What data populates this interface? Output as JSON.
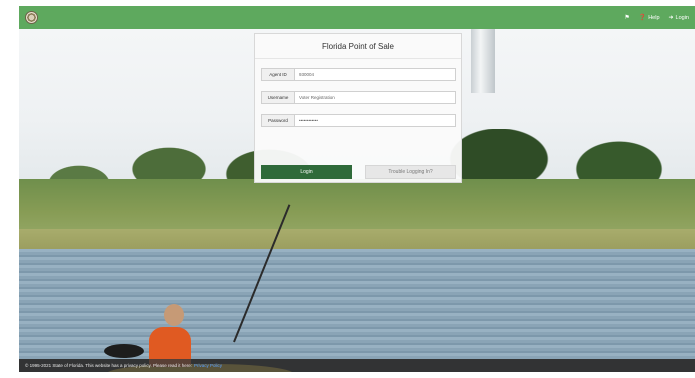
{
  "header": {
    "help_label": "Help",
    "login_label": "Login",
    "icons": [
      "state-seal-icon",
      "bell-icon",
      "help-icon",
      "login-icon"
    ]
  },
  "login": {
    "title": "Florida Point of Sale",
    "agent_id": {
      "label": "Agent ID",
      "value": "930004"
    },
    "username": {
      "label": "Username",
      "value": "Voter Registration"
    },
    "password": {
      "label": "Password",
      "value": "••••••••••••"
    },
    "login_button": "Login",
    "trouble_button": "Trouble Logging In?"
  },
  "footer": {
    "text": "© 1995-2021 State of Florida. This website has a privacy policy. Please read it here:",
    "link": "Privacy Policy"
  },
  "colors": {
    "header_green": "#5ea95e",
    "button_green": "#2f6a3a",
    "link_blue": "#5aa0ff"
  }
}
